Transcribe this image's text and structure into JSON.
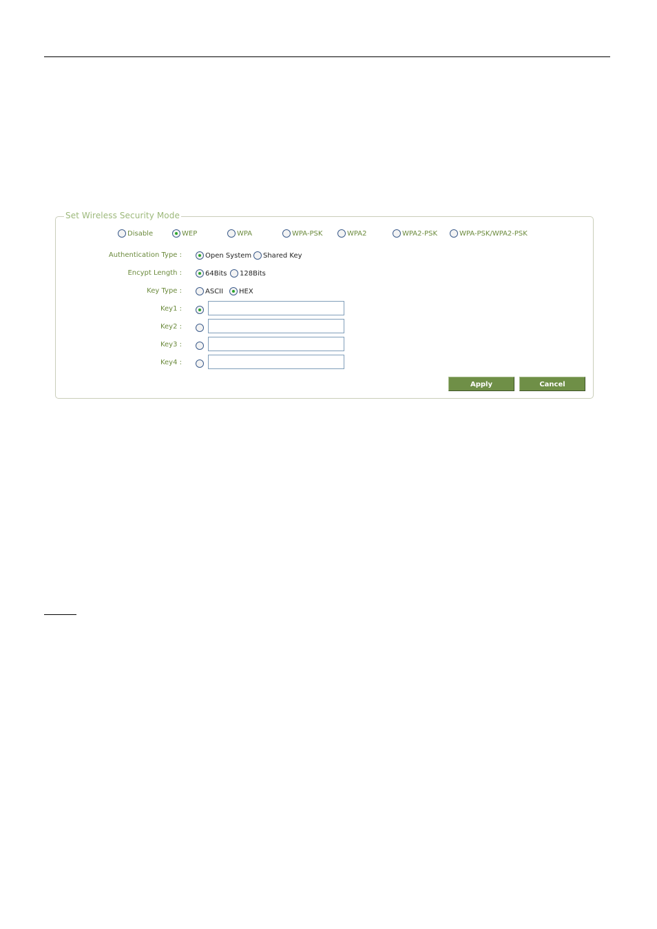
{
  "legend": "Set Wireless Security Mode",
  "security_modes": [
    {
      "label": "Disable",
      "selected": false
    },
    {
      "label": "WEP",
      "selected": true
    },
    {
      "label": "WPA",
      "selected": false
    },
    {
      "label": "WPA-PSK",
      "selected": false
    },
    {
      "label": "WPA2",
      "selected": false
    },
    {
      "label": "WPA2-PSK",
      "selected": false
    },
    {
      "label": "WPA-PSK/WPA2-PSK",
      "selected": false
    }
  ],
  "auth_type": {
    "label": "Authentication Type :",
    "options": [
      {
        "label": "Open System",
        "selected": true
      },
      {
        "label": "Shared Key",
        "selected": false
      }
    ]
  },
  "encrypt_length": {
    "label": "Encypt Length :",
    "options": [
      {
        "label": "64Bits",
        "selected": true
      },
      {
        "label": "128Bits",
        "selected": false
      }
    ]
  },
  "key_type": {
    "label": "Key Type :",
    "options": [
      {
        "label": "ASCII",
        "selected": false
      },
      {
        "label": "HEX",
        "selected": true
      }
    ]
  },
  "keys": [
    {
      "label": "Key1 :",
      "selected": true,
      "value": ""
    },
    {
      "label": "Key2 :",
      "selected": false,
      "value": ""
    },
    {
      "label": "Key3 :",
      "selected": false,
      "value": ""
    },
    {
      "label": "Key4 :",
      "selected": false,
      "value": ""
    }
  ],
  "buttons": {
    "apply": "Apply",
    "cancel": "Cancel"
  }
}
